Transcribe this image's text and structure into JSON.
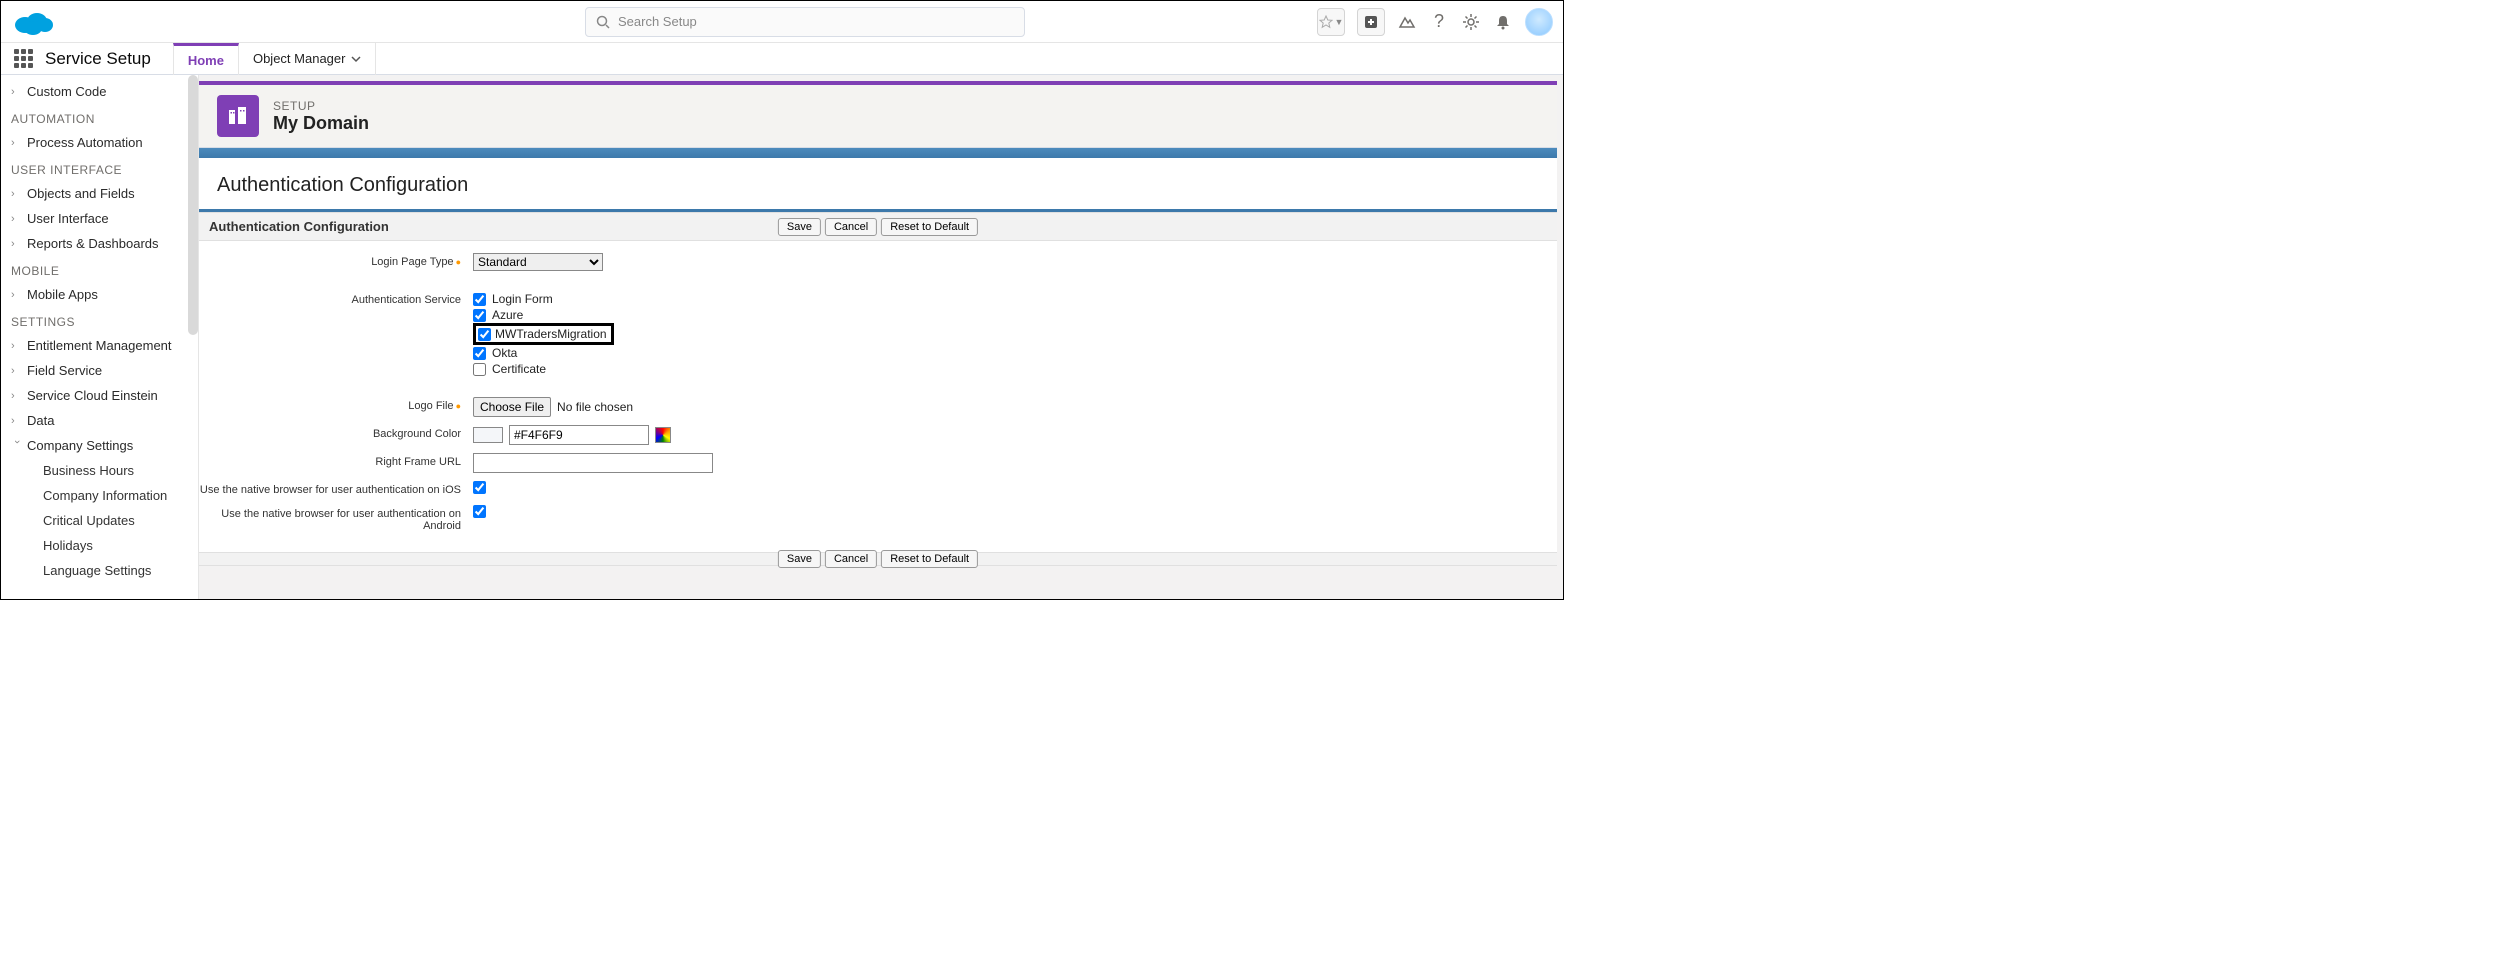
{
  "header": {
    "search_placeholder": "Search Setup"
  },
  "nav": {
    "app_title": "Service Setup",
    "tab_home": "Home",
    "tab_objmgr": "Object Manager"
  },
  "sidebar": {
    "custom_code": "Custom Code",
    "automation_head": "AUTOMATION",
    "process_automation": "Process Automation",
    "ui_head": "USER INTERFACE",
    "objects_fields": "Objects and Fields",
    "user_interface": "User Interface",
    "reports_dash": "Reports & Dashboards",
    "mobile_head": "MOBILE",
    "mobile_apps": "Mobile Apps",
    "settings_head": "SETTINGS",
    "entitlement": "Entitlement Management",
    "field_service": "Field Service",
    "sce": "Service Cloud Einstein",
    "data": "Data",
    "company_settings": "Company Settings",
    "children": {
      "business_hours": "Business Hours",
      "company_info": "Company Information",
      "critical_updates": "Critical Updates",
      "holidays": "Holidays",
      "language_settings": "Language Settings"
    }
  },
  "page": {
    "crumb": "SETUP",
    "title": "My Domain",
    "section_title": "Authentication Configuration",
    "band_title": "Authentication Configuration",
    "btn_save": "Save",
    "btn_cancel": "Cancel",
    "btn_reset": "Reset to Default"
  },
  "form": {
    "login_page_type_label": "Login Page Type",
    "login_page_type_value": "Standard",
    "auth_service_label": "Authentication Service",
    "auth_login_form": "Login Form",
    "auth_azure": "Azure",
    "auth_mwtraders": "MWTradersMigration",
    "auth_okta": "Okta",
    "auth_certificate": "Certificate",
    "logo_file_label": "Logo File",
    "choose_file": "Choose File",
    "no_file_chosen": "No file chosen",
    "bg_color_label": "Background Color",
    "bg_color_value": "#F4F6F9",
    "right_frame_label": "Right Frame URL",
    "right_frame_value": "",
    "ios_label": "Use the native browser for user authentication on iOS",
    "android_label": "Use the native browser for user authentication on Android"
  }
}
